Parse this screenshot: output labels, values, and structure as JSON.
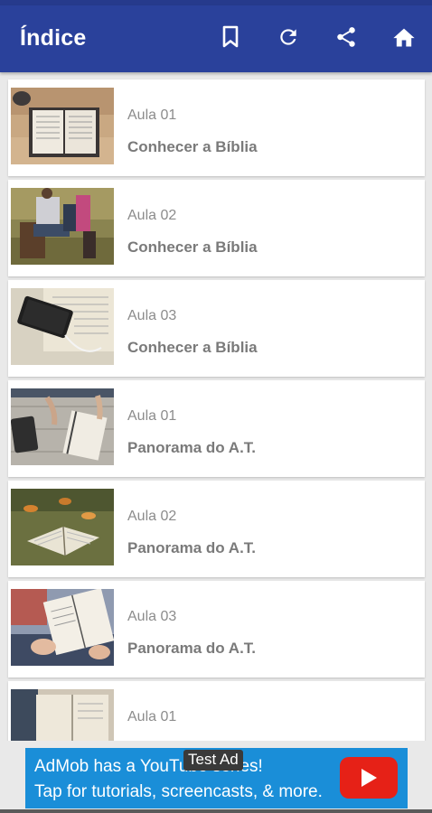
{
  "appbar": {
    "title": "Índice",
    "actions": [
      {
        "name": "bookmark-icon"
      },
      {
        "name": "refresh-icon"
      },
      {
        "name": "share-icon"
      },
      {
        "name": "home-icon"
      }
    ]
  },
  "lessons": [
    {
      "subtitle": "Aula 01",
      "title": "Conhecer a Bíblia"
    },
    {
      "subtitle": "Aula 02",
      "title": "Conhecer a Bíblia"
    },
    {
      "subtitle": "Aula 03",
      "title": "Conhecer a Bíblia"
    },
    {
      "subtitle": "Aula 01",
      "title": "Panorama do A.T."
    },
    {
      "subtitle": "Aula 02",
      "title": "Panorama do A.T."
    },
    {
      "subtitle": "Aula 03",
      "title": "Panorama do A.T."
    },
    {
      "subtitle": "Aula 01",
      "title": ""
    }
  ],
  "ad": {
    "badge": "Test Ad",
    "line1": "AdMob has a YouTube series!",
    "line2": "Tap for tutorials, screencasts, & more."
  },
  "colors": {
    "appbar": "#2a419b",
    "ad_background": "#1a8ed8",
    "youtube_red": "#e62117"
  }
}
